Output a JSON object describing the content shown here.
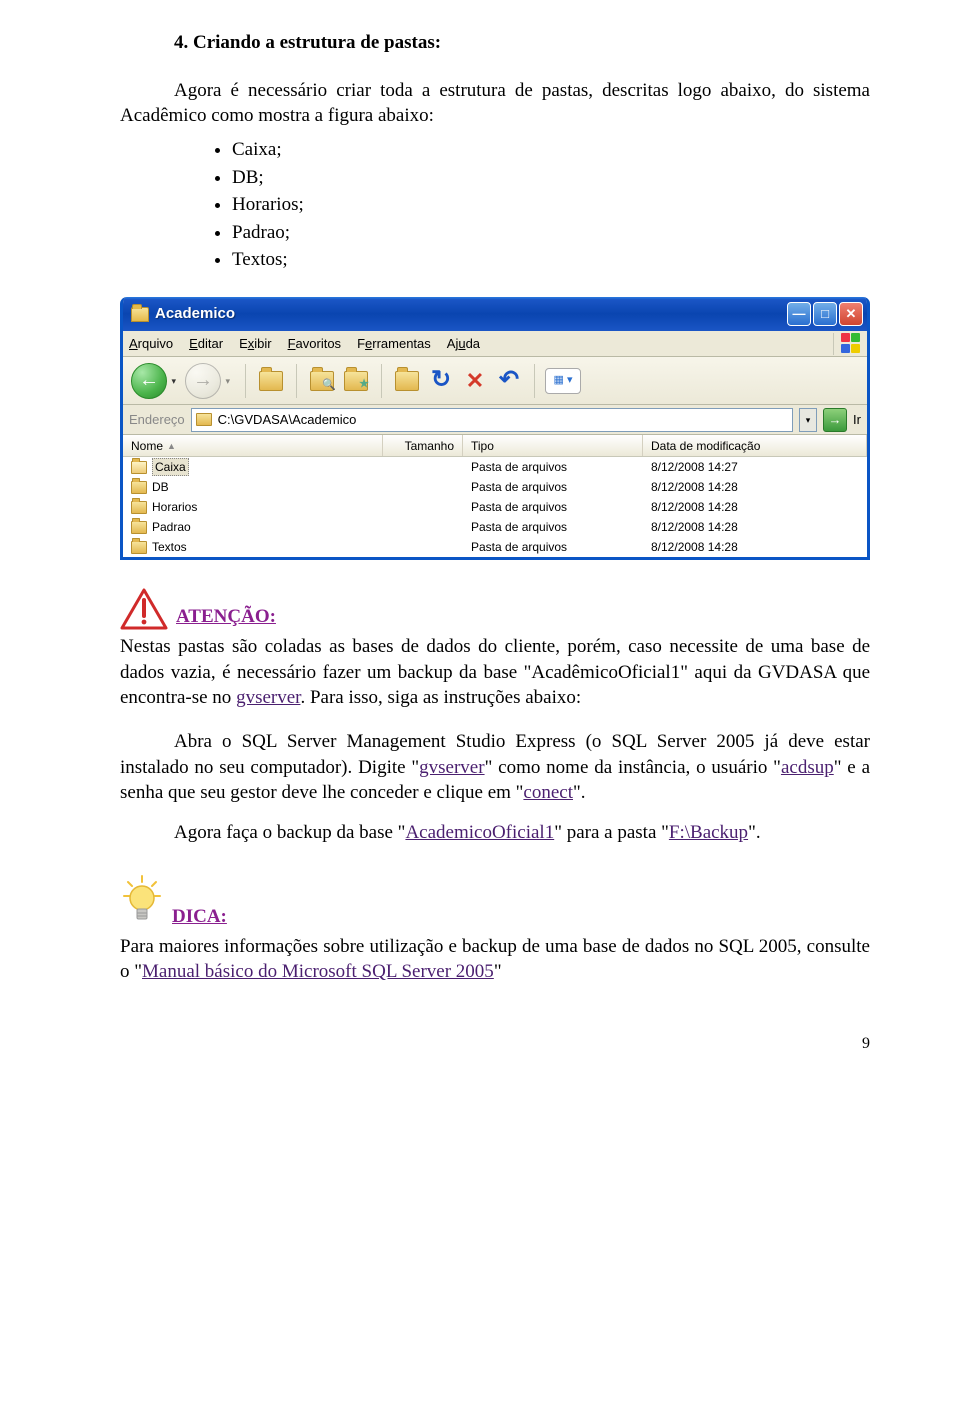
{
  "heading": "4. Criando a estrutura de pastas:",
  "intro": "Agora é necessário criar toda a estrutura de pastas, descritas logo abaixo, do sistema Acadêmico como mostra a figura abaixo:",
  "bullets": [
    "Caixa;",
    "DB;",
    "Horarios;",
    "Padrao;",
    "Textos;"
  ],
  "explorer": {
    "title": "Academico",
    "menu": {
      "m1": "Arquivo",
      "m2": "Editar",
      "m3": "Exibir",
      "m4": "Favoritos",
      "m5": "Ferramentas",
      "m6": "Ajuda"
    },
    "address_label": "Endereço",
    "address_path": "C:\\GVDASA\\Academico",
    "go_label": "Ir",
    "cols": {
      "name": "Nome",
      "size": "Tamanho",
      "type": "Tipo",
      "date": "Data de modificação"
    },
    "rows": [
      {
        "name": "Caixa",
        "type": "Pasta de arquivos",
        "date": "8/12/2008 14:27",
        "selected": true
      },
      {
        "name": "DB",
        "type": "Pasta de arquivos",
        "date": "8/12/2008 14:28",
        "selected": false
      },
      {
        "name": "Horarios",
        "type": "Pasta de arquivos",
        "date": "8/12/2008 14:28",
        "selected": false
      },
      {
        "name": "Padrao",
        "type": "Pasta de arquivos",
        "date": "8/12/2008 14:28",
        "selected": false
      },
      {
        "name": "Textos",
        "type": "Pasta de arquivos",
        "date": "8/12/2008 14:28",
        "selected": false
      }
    ]
  },
  "attn": {
    "label": "ATENÇÃO:",
    "p1a": "Nestas pastas são coladas as bases de dados do cliente, porém, caso necessite de uma base de dados vazia, é necessário fazer um backup da base \"AcadêmicoOficial1\" aqui da GVDASA que encontra-se no ",
    "p1_link": "gvserver",
    "p1b": ". Para isso, siga as instruções abaixo:"
  },
  "p2": {
    "a": "Abra o SQL Server Management Studio Express (o SQL Server 2005 já deve estar instalado no seu computador). Digite \"",
    "l1": "gvserver",
    "b": "\" como nome da instância, o usuário \"",
    "l2": "acdsup",
    "c": "\" e a senha que seu gestor deve lhe conceder e clique em \"",
    "l3": "conect",
    "d": "\"."
  },
  "p3": {
    "a": "Agora faça o backup da base \"",
    "l1": "AcademicoOficial1",
    "b": "\" para a pasta \"",
    "l2": "F:\\Backup",
    "c": "\"."
  },
  "dica": {
    "label": "DICA:",
    "a": "Para maiores informações sobre utilização e backup de uma base de dados no SQL 2005, consulte o \"",
    "l1": "Manual básico do Microsoft SQL Server 2005",
    "b": "\""
  },
  "page_num": "9"
}
